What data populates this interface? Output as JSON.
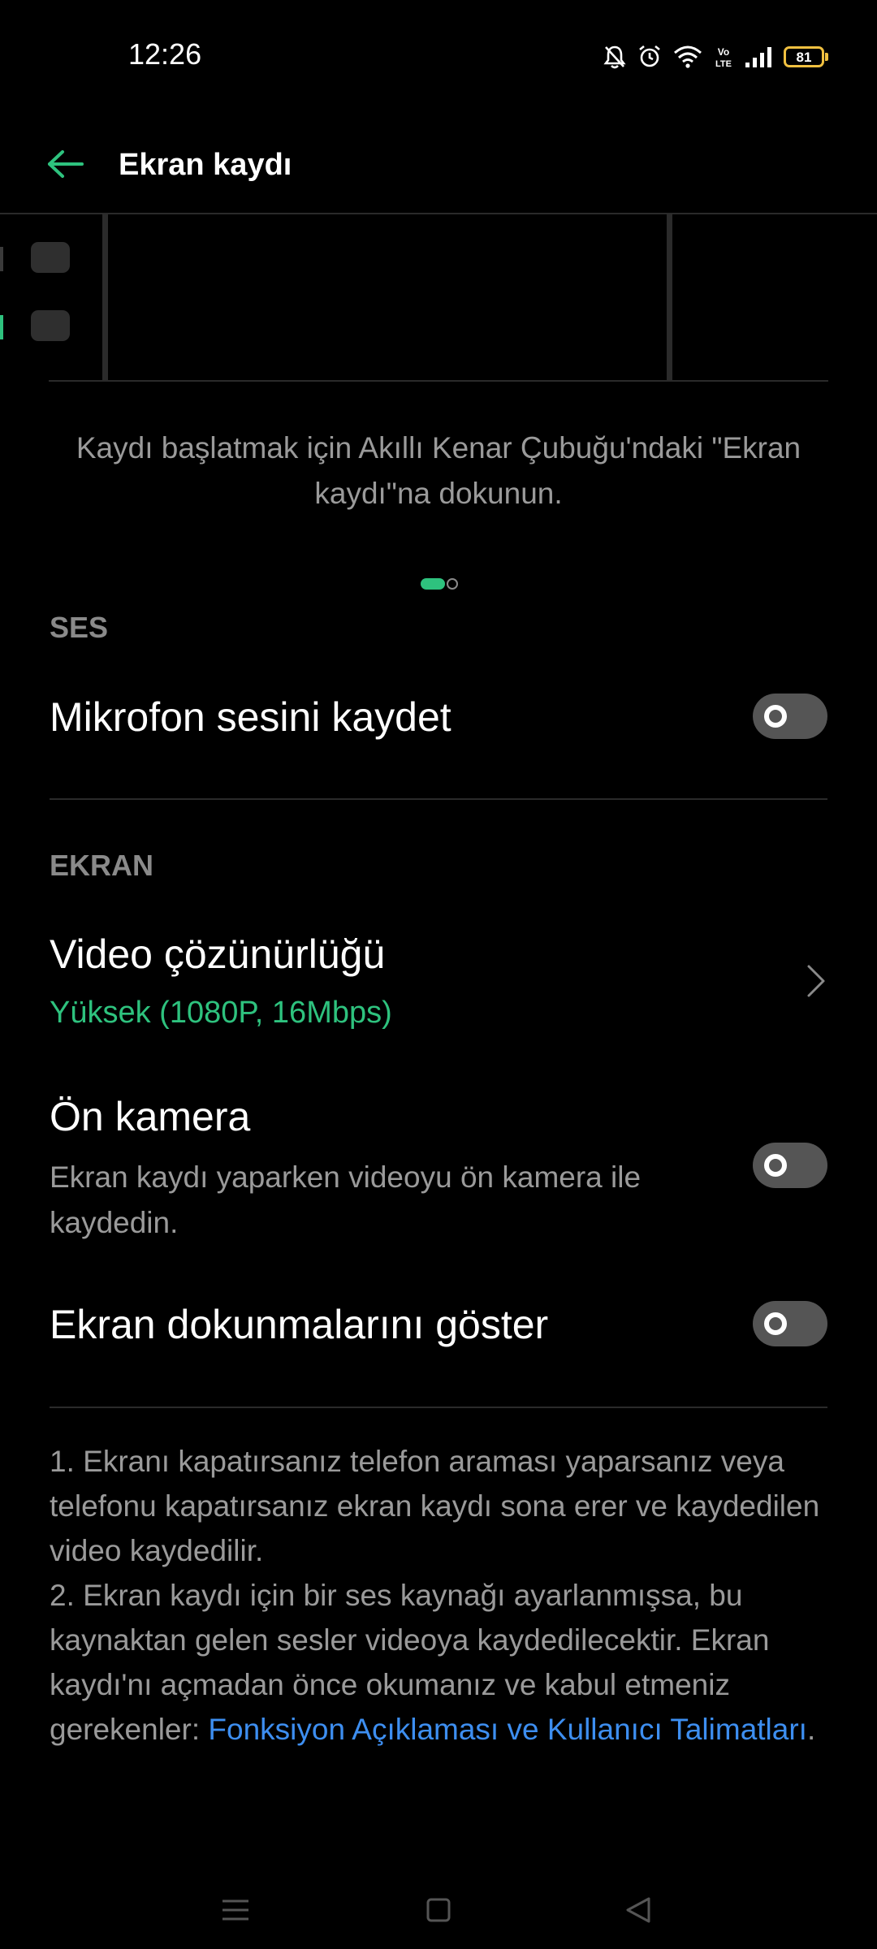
{
  "status_bar": {
    "time": "12:26",
    "battery_level": "81",
    "icons": [
      "bell-off-icon",
      "alarm-icon",
      "wifi-icon",
      "volte-icon",
      "signal-icon",
      "battery-icon"
    ]
  },
  "header": {
    "title": "Ekran kaydı",
    "back_icon": "arrow-left-icon"
  },
  "caption": "Kaydı başlatmak için Akıllı Kenar Çubuğu'ndaki \"Ekran kaydı\"na dokunun.",
  "pager": {
    "current_page": 1,
    "total_pages": 2
  },
  "sections": {
    "audio": {
      "header": "SES",
      "mic_title": "Mikrofon sesini kaydet",
      "mic_enabled": false
    },
    "screen": {
      "header": "EKRAN",
      "resolution_title": "Video çözünürlüğü",
      "resolution_value": "Yüksek (1080P, 16Mbps)",
      "front_camera_title": "Ön kamera",
      "front_camera_subtitle": "Ekran kaydı yaparken videoyu ön kamera ile kaydedin.",
      "front_camera_enabled": false,
      "touches_title": "Ekran dokunmalarını göster",
      "touches_enabled": false
    }
  },
  "notes": {
    "line1": "1. Ekranı kapatırsanız telefon araması yaparsanız veya telefonu kapatırsanız ekran kaydı sona erer ve kaydedilen video kaydedilir.",
    "line2": "2. Ekran kaydı için bir ses kaynağı ayarlanmışsa, bu kaynaktan gelen sesler videoya kaydedilecektir. Ekran kaydı'nı açmadan önce okumanız ve kabul etmeniz gerekenler: ",
    "link": "Fonksiyon Açıklaması ve Kullanıcı Talimatları",
    "tail": "."
  },
  "colors": {
    "accent": "#2ec27e",
    "link": "#3d8ef0",
    "background": "#000000",
    "secondary_text": "#9a9a9a"
  }
}
